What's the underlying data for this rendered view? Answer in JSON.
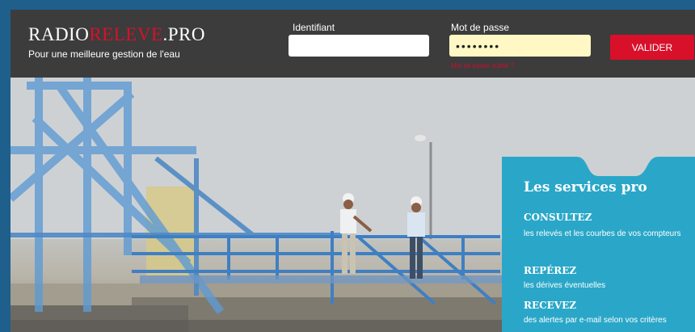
{
  "header": {
    "logo": {
      "part1": "RADIO",
      "part2": "RELEVE",
      "part3": ".PRO"
    },
    "tagline": "Pour une meilleure gestion de l'eau",
    "login": {
      "id_label": "Identifiant",
      "id_value": "",
      "pw_label": "Mot de passe",
      "pw_value": "••••••••",
      "forgot": "Mot de passe oublié ?",
      "submit": "VALIDER"
    }
  },
  "services": {
    "title": "Les services pro",
    "items": [
      {
        "heading": "CONSULTEZ",
        "text": "les relevés et les courbes de vos compteurs"
      },
      {
        "heading": "REPÉREZ",
        "text": "les dérives éventuelles"
      },
      {
        "heading": "RECEVEZ",
        "text": "des alertes par e-mail selon vos critères"
      }
    ]
  },
  "colors": {
    "page_bg": "#1f5f8c",
    "header_bg": "#3c3c3c",
    "brand_red": "#d8102a",
    "services_bg": "#2aa7c8",
    "password_bg": "#fff8c4"
  }
}
